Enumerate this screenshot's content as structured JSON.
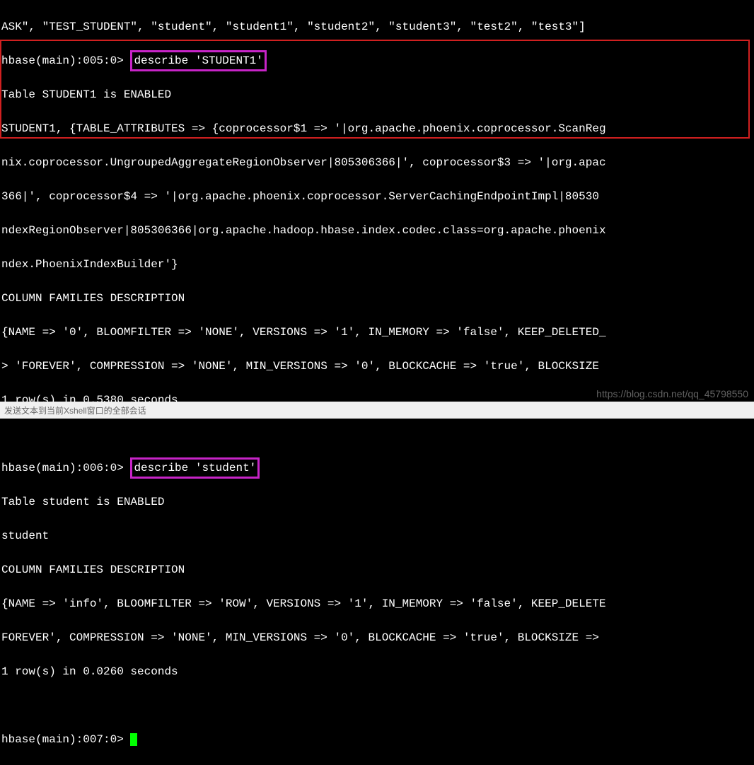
{
  "lines": {
    "l0": "ASK\", \"TEST_STUDENT\", \"student\", \"student1\", \"student2\", \"student3\", \"test2\", \"test3\"]",
    "prompt1_prefix": "hbase(main):005:0> ",
    "cmd1": "describe 'STUDENT1'",
    "l2": "Table STUDENT1 is ENABLED",
    "l3": "STUDENT1, {TABLE_ATTRIBUTES => {coprocessor$1 => '|org.apache.phoenix.coprocessor.ScanReg",
    "l4": "nix.coprocessor.UngroupedAggregateRegionObserver|805306366|', coprocessor$3 => '|org.apac",
    "l5": "366|', coprocessor$4 => '|org.apache.phoenix.coprocessor.ServerCachingEndpointImpl|80530",
    "l6": "ndexRegionObserver|805306366|org.apache.hadoop.hbase.index.codec.class=org.apache.phoenix",
    "l7": "ndex.PhoenixIndexBuilder'}",
    "l8": "COLUMN FAMILIES DESCRIPTION",
    "l9": "{NAME => '0', BLOOMFILTER => 'NONE', VERSIONS => '1', IN_MEMORY => 'false', KEEP_DELETED_",
    "l10": "> 'FOREVER', COMPRESSION => 'NONE', MIN_VERSIONS => '0', BLOCKCACHE => 'true', BLOCKSIZE ",
    "l11": "1 row(s) in 0.5380 seconds",
    "prompt2_prefix": "hbase(main):006:0> ",
    "cmd2": "describe 'student'",
    "l14": "Table student is ENABLED",
    "l15": "student",
    "l16": "COLUMN FAMILIES DESCRIPTION",
    "l17": "{NAME => 'info', BLOOMFILTER => 'ROW', VERSIONS => '1', IN_MEMORY => 'false', KEEP_DELETE",
    "l18": "FOREVER', COMPRESSION => 'NONE', MIN_VERSIONS => '0', BLOCKCACHE => 'true', BLOCKSIZE => ",
    "l19": "1 row(s) in 0.0260 seconds",
    "prompt3_prefix": "hbase(main):007:0> "
  },
  "watermark": "https://blog.csdn.net/qq_45798550",
  "bottom_text": "发送文本到当前Xshell窗口的全部会话"
}
